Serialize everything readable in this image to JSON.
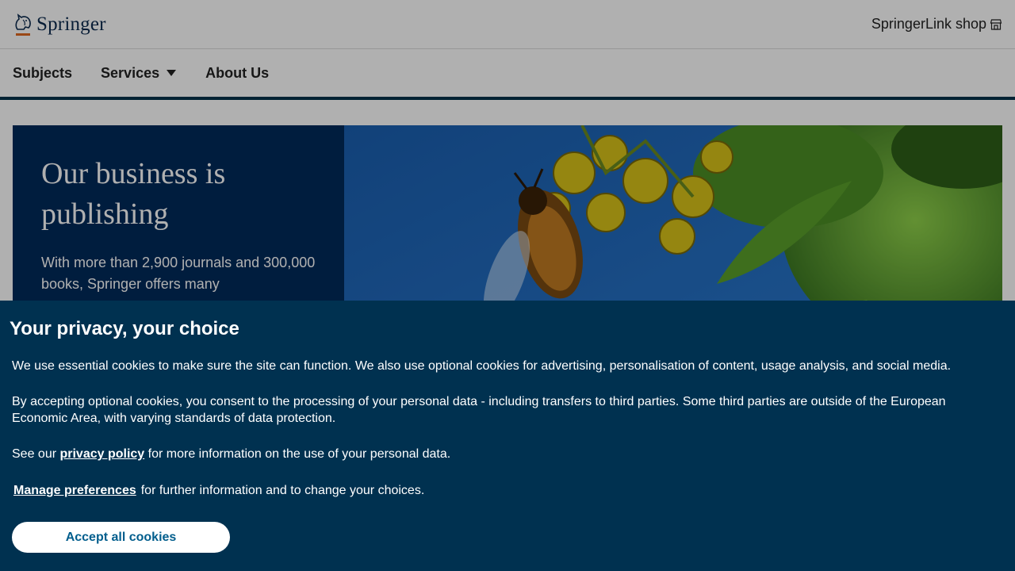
{
  "header": {
    "brand": "Springer",
    "shop_link": "SpringerLink shop",
    "shop_icon": "storefront-icon"
  },
  "nav": {
    "items": [
      {
        "label": "Subjects"
      },
      {
        "label": "Services",
        "icon": "caret-down-icon"
      },
      {
        "label": "About Us"
      }
    ]
  },
  "hero": {
    "title": "Our business is publishing",
    "description": "With more than 2,900 journals and 300,000 books, Springer offers many",
    "image": "bee-on-yellow-flowers-photo"
  },
  "cookie_banner": {
    "title": "Your privacy, your choice",
    "p1": "We use essential cookies to make sure the site can function. We also use optional cookies for advertising, personalisation of content, usage analysis, and social media.",
    "p2": "By accepting optional cookies, you consent to the processing of your personal data - including transfers to third parties. Some third parties are outside of the European Economic Area, with varying standards of data protection.",
    "p3_before": "See our ",
    "p3_link": "privacy policy",
    "p3_after": " for more information on the use of your personal data.",
    "manage_link": "Manage preferences",
    "p4_after": "for further information and to change your choices.",
    "accept_button": "Accept all cookies"
  },
  "colors": {
    "brand_navy": "#0c2b4f",
    "hero_panel": "#012a5b",
    "banner_bg": "#003150",
    "accept_text": "#025e8d",
    "logo_accent": "#e0671f"
  }
}
